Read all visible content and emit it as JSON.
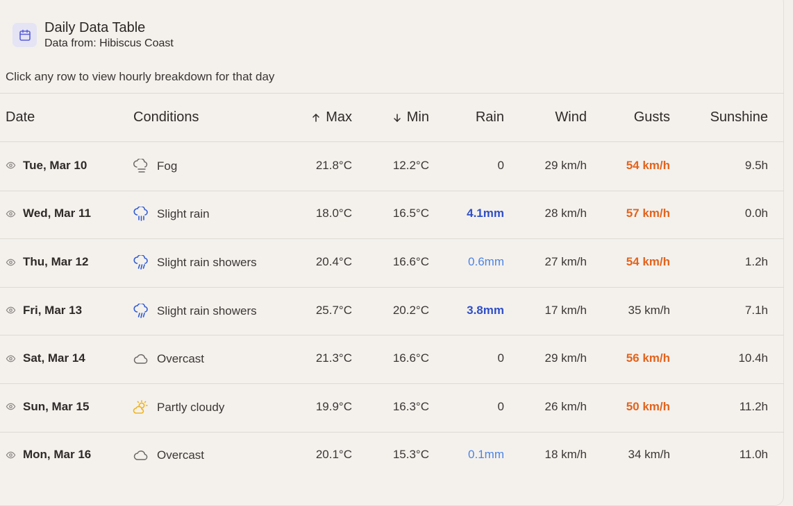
{
  "header": {
    "title": "Daily Data Table",
    "subtitle_prefix": "Data from:",
    "location": "Hibiscus Coast",
    "icon": "calendar-icon",
    "accent": "#5b5fd6"
  },
  "hint": "Click any row to view hourly breakdown for that day",
  "columns": {
    "date": "Date",
    "conditions": "Conditions",
    "max": "Max",
    "min": "Min",
    "rain": "Rain",
    "wind": "Wind",
    "gusts": "Gusts",
    "sunshine": "Sunshine"
  },
  "colors": {
    "rain_heavy": "#2f4fc7",
    "rain_light": "#4c84e3",
    "gust_high": "#e2631c",
    "sun_icon": "#f0b21c"
  },
  "rows": [
    {
      "date": "Tue, Mar 10",
      "icon": "fog-icon",
      "conditions": "Fog",
      "max": "21.8°C",
      "min": "12.2°C",
      "rain": "0",
      "wind": "29 km/h",
      "gusts": "54 km/h",
      "sunshine": "9.5h"
    },
    {
      "date": "Wed, Mar 11",
      "icon": "rain-icon",
      "conditions": "Slight rain",
      "max": "18.0°C",
      "min": "16.5°C",
      "rain": "4.1mm",
      "wind": "28 km/h",
      "gusts": "57 km/h",
      "sunshine": "0.0h"
    },
    {
      "date": "Thu, Mar 12",
      "icon": "rain-showers-icon",
      "conditions": "Slight rain showers",
      "max": "20.4°C",
      "min": "16.6°C",
      "rain": "0.6mm",
      "wind": "27 km/h",
      "gusts": "54 km/h",
      "sunshine": "1.2h"
    },
    {
      "date": "Fri, Mar 13",
      "icon": "rain-showers-icon",
      "conditions": "Slight rain showers",
      "max": "25.7°C",
      "min": "20.2°C",
      "rain": "3.8mm",
      "wind": "17 km/h",
      "gusts": "35 km/h",
      "sunshine": "7.1h"
    },
    {
      "date": "Sat, Mar 14",
      "icon": "cloud-icon",
      "conditions": "Overcast",
      "max": "21.3°C",
      "min": "16.6°C",
      "rain": "0",
      "wind": "29 km/h",
      "gusts": "56 km/h",
      "sunshine": "10.4h"
    },
    {
      "date": "Sun, Mar 15",
      "icon": "partly-cloudy-icon",
      "conditions": "Partly cloudy",
      "max": "19.9°C",
      "min": "16.3°C",
      "rain": "0",
      "wind": "26 km/h",
      "gusts": "50 km/h",
      "sunshine": "11.2h"
    },
    {
      "date": "Mon, Mar 16",
      "icon": "cloud-icon",
      "conditions": "Overcast",
      "max": "20.1°C",
      "min": "15.3°C",
      "rain": "0.1mm",
      "wind": "18 km/h",
      "gusts": "34 km/h",
      "sunshine": "11.0h"
    }
  ]
}
